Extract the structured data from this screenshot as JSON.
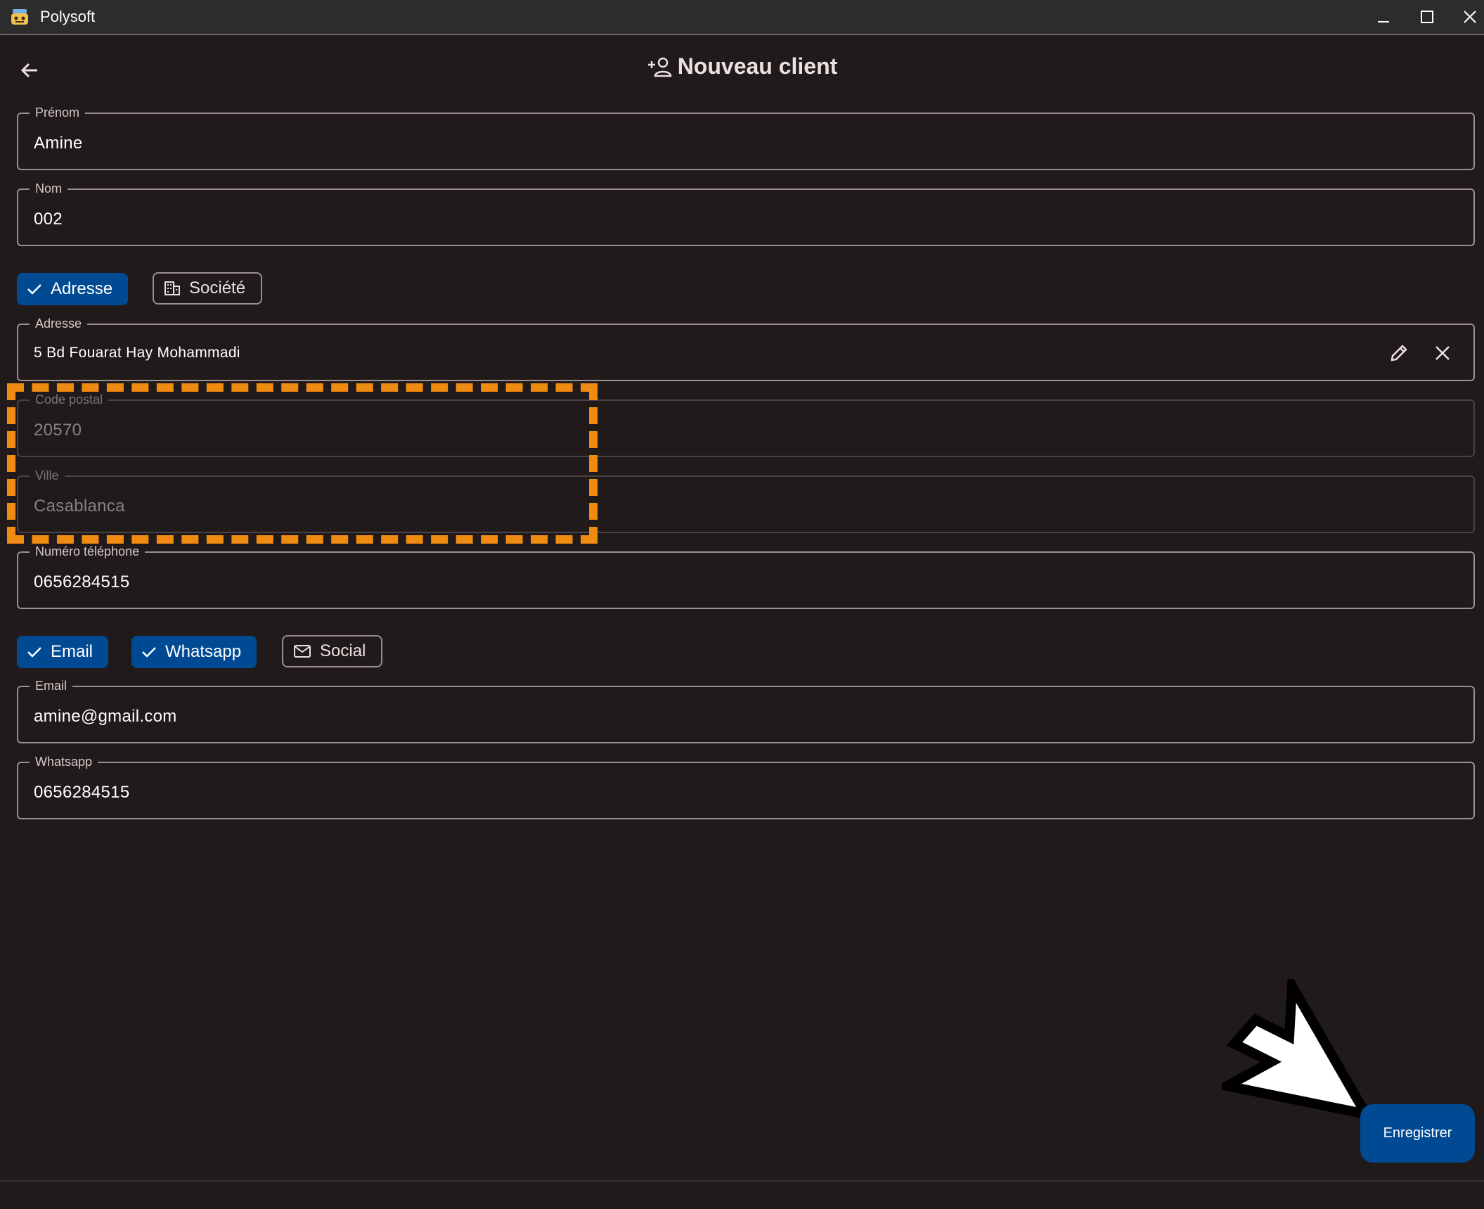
{
  "window": {
    "title": "Polysoft"
  },
  "header": {
    "title": "Nouveau client",
    "title_icon": "person-add-icon",
    "back_icon": "arrow-back-icon"
  },
  "fields": {
    "prenom": {
      "label": "Prénom",
      "value": "Amine"
    },
    "nom": {
      "label": "Nom",
      "value": "002"
    },
    "adresse": {
      "label": "Adresse",
      "value": "5 Bd Fouarat Hay Mohammadi"
    },
    "code_postal": {
      "label": "Code postal",
      "value": "20570"
    },
    "ville": {
      "label": "Ville",
      "value": "Casablanca"
    },
    "telephone": {
      "label": "Numéro téléphone",
      "value": "0656284515"
    },
    "email": {
      "label": "Email",
      "value": "amine@gmail.com"
    },
    "whatsapp": {
      "label": "Whatsapp",
      "value": "0656284515"
    }
  },
  "chips": {
    "adresse": {
      "label": "Adresse",
      "selected": true
    },
    "societe": {
      "label": "Société",
      "selected": false
    },
    "email": {
      "label": "Email",
      "selected": true
    },
    "whatsapp": {
      "label": "Whatsapp",
      "selected": true
    },
    "social": {
      "label": "Social",
      "selected": false
    }
  },
  "actions": {
    "save_label": "Enregistrer"
  },
  "colors": {
    "background": "#201a1b",
    "accent": "#004a94",
    "highlight": "#f08b12"
  }
}
